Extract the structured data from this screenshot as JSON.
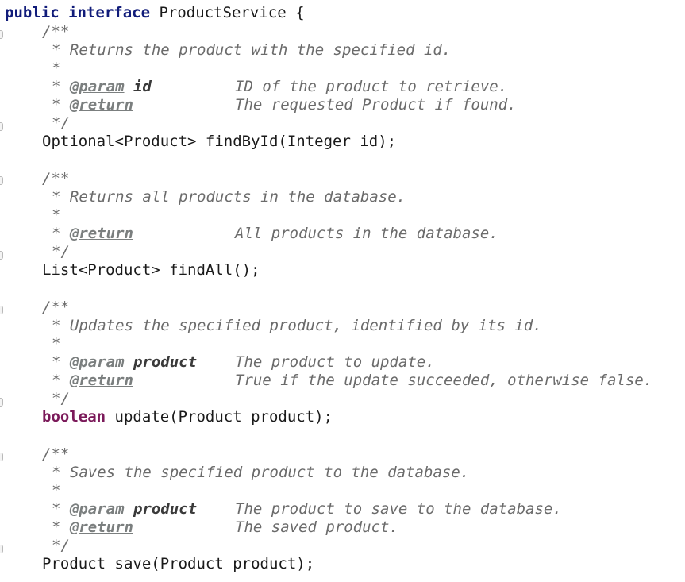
{
  "code": {
    "header": {
      "public": "public",
      "interface": "interface",
      "name": " ProductService {"
    },
    "block1": {
      "open": "/**",
      "summary": "* Returns the product with the specified id.",
      "blank": "*",
      "star_param": "* ",
      "param_tag": "@param",
      "param_name": "id",
      "param_desc": "ID of the product to retrieve.",
      "star_return": "* ",
      "return_tag": "@return",
      "return_desc": "The requested Product if found.",
      "close": "*/",
      "signature": "Optional<Product> findById(Integer id);"
    },
    "block2": {
      "open": "/**",
      "summary": "* Returns all products in the database.",
      "blank": "*",
      "star_return": "* ",
      "return_tag": "@return",
      "return_desc": "All products in the database.",
      "close": "*/",
      "signature": "List<Product> findAll();"
    },
    "block3": {
      "open": "/**",
      "summary": "* Updates the specified product, identified by its id.",
      "blank": "*",
      "star_param": "* ",
      "param_tag": "@param",
      "param_name": "product",
      "param_desc": "The product to update.",
      "star_return": "* ",
      "return_tag": "@return",
      "return_desc": "True if the update succeeded, otherwise false.",
      "close": "*/",
      "sig_keyword": "boolean",
      "sig_rest": " update(Product product);"
    },
    "block4": {
      "open": "/**",
      "summary": "* Saves the specified product to the database.",
      "blank": "*",
      "star_param": "* ",
      "param_tag": "@param",
      "param_name": "product",
      "param_desc": "The product to save to the database.",
      "star_return": "* ",
      "return_tag": "@return",
      "return_desc": "The saved product.",
      "close": "*/",
      "signature": "Product save(Product product);"
    }
  },
  "colors": {
    "keyword": "#7b1a5a",
    "keyword_blue": "#111c7a",
    "comment": "#6b6b6b",
    "javadoc_tag": "#7b7f7f",
    "text": "#1a1a1a"
  }
}
